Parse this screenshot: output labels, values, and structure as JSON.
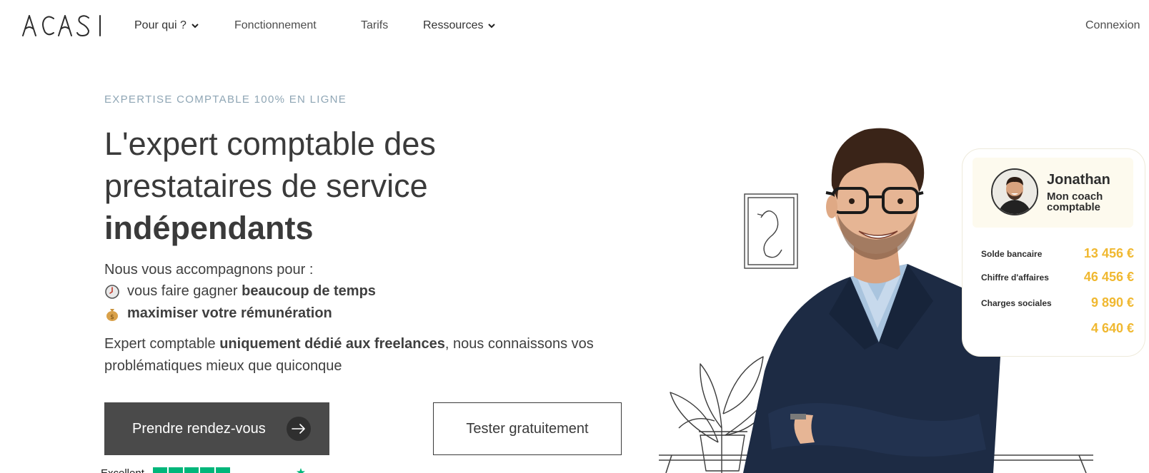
{
  "header": {
    "logo_text": "ACASI",
    "nav": {
      "pour_qui": "Pour qui ?",
      "fonctionnement": "Fonctionnement",
      "tarifs": "Tarifs",
      "ressources": "Ressources",
      "connexion": "Connexion"
    }
  },
  "hero": {
    "eyebrow": "EXPERTISE COMPTABLE 100% EN LIGNE",
    "title_line1": "L'expert comptable des",
    "title_line2": "prestataires de service",
    "title_line3": "indépendants",
    "intro": "Nous vous accompagnons pour :",
    "bullet1_prefix": "vous faire gagner ",
    "bullet1_bold": "beaucoup de temps",
    "bullet2_bold": "maximiser votre rémunération",
    "desc_prefix": "Expert comptable ",
    "desc_bold": "uniquement dédié aux freelances",
    "desc_suffix": ", nous connaissons vos problématiques mieux que quiconque"
  },
  "buttons": {
    "primary": "Prendre rendez-vous",
    "secondary": "Tester gratuitement"
  },
  "trust": {
    "label": "Excellent",
    "stars": 5
  },
  "coach_card": {
    "name": "Jonathan",
    "role": "Mon coach comptable",
    "rows": [
      {
        "label": "Solde bancaire",
        "value": "13 456 €"
      },
      {
        "label": "Chiffre d'affaires",
        "value": "46 456 €"
      },
      {
        "label": "Charges sociales",
        "value": "9 890 €"
      },
      {
        "label": "",
        "value": "4 640 €"
      }
    ]
  },
  "colors": {
    "eyebrow": "#8fa6b5",
    "primary_button": "#4a4a4a",
    "kpi_value": "#f0b830",
    "card_head": "#fdfaee",
    "trustpilot_green": "#00b67a"
  },
  "icons": {
    "bullet1": "clock-icon",
    "bullet2": "money-bag-icon",
    "button_arrow": "arrow-right-icon",
    "nav_dropdown": "chevron-down-icon"
  }
}
